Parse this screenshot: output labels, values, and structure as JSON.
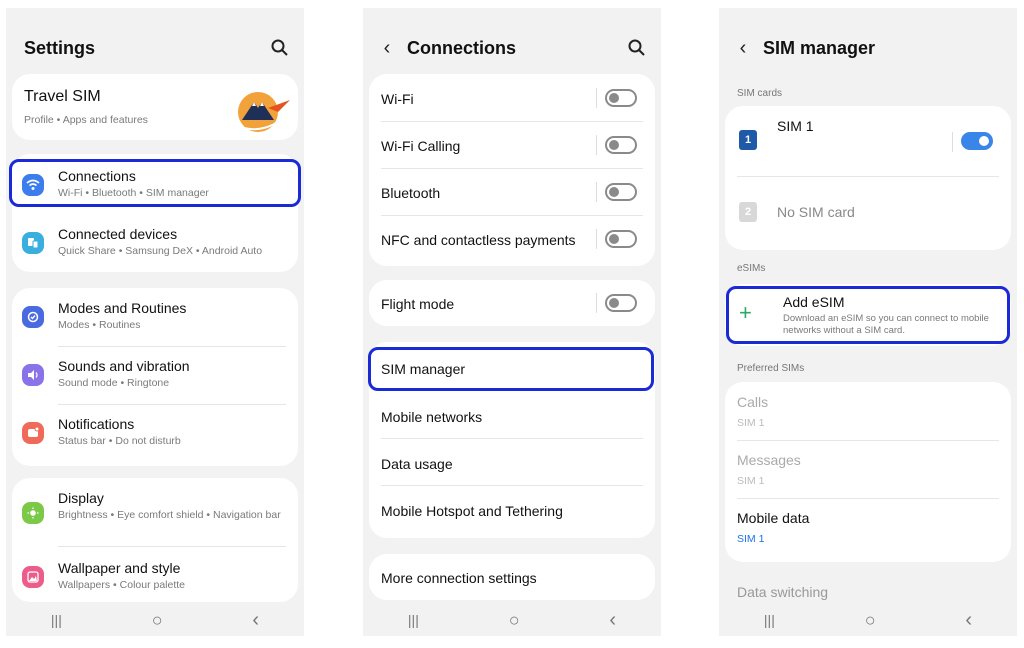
{
  "settings": {
    "title": "Settings",
    "profile": {
      "name": "Travel SIM",
      "sub": "Profile • Apps and features"
    },
    "items": [
      {
        "label": "Connections",
        "sub": "Wi-Fi • Bluetooth • SIM manager",
        "icon": "wifi-icon",
        "color": "#3b7ded"
      },
      {
        "label": "Connected devices",
        "sub": "Quick Share • Samsung DeX • Android Auto",
        "icon": "connected-devices-icon",
        "color": "#3aaede"
      },
      {
        "label": "Modes and Routines",
        "sub": "Modes • Routines",
        "icon": "modes-icon",
        "color": "#4a6be0"
      },
      {
        "label": "Sounds and vibration",
        "sub": "Sound mode • Ringtone",
        "icon": "sound-icon",
        "color": "#8a72e8"
      },
      {
        "label": "Notifications",
        "sub": "Status bar • Do not disturb",
        "icon": "notifications-icon",
        "color": "#f06a5a"
      },
      {
        "label": "Display",
        "sub": "Brightness • Eye comfort shield • Navigation bar",
        "icon": "display-icon",
        "color": "#7cc94a"
      },
      {
        "label": "Wallpaper and style",
        "sub": "Wallpapers • Colour palette",
        "icon": "wallpaper-icon",
        "color": "#ec5d8b"
      }
    ]
  },
  "connections": {
    "title": "Connections",
    "toggles": [
      {
        "label": "Wi-Fi",
        "on": false
      },
      {
        "label": "Wi-Fi Calling",
        "on": false
      },
      {
        "label": "Bluetooth",
        "on": false
      },
      {
        "label": "NFC and contactless payments",
        "on": false
      }
    ],
    "flight_mode": "Flight mode",
    "items": [
      "SIM manager",
      "Mobile networks",
      "Data usage",
      "Mobile Hotspot and Tethering"
    ],
    "more": "More connection settings"
  },
  "sim_manager": {
    "title": "SIM manager",
    "sim_cards_label": "SIM cards",
    "sim1": {
      "label": "SIM 1",
      "badge": "1",
      "on": true
    },
    "sim2": {
      "label": "No SIM card",
      "badge": "2"
    },
    "esims_label": "eSIMs",
    "add_esim": {
      "label": "Add eSIM",
      "sub": "Download an eSIM so you can connect to mobile networks without a SIM card."
    },
    "preferred_label": "Preferred SIMs",
    "calls": {
      "label": "Calls",
      "value": "SIM 1"
    },
    "messages": {
      "label": "Messages",
      "value": "SIM 1"
    },
    "mobile_data": {
      "label": "Mobile data",
      "value": "SIM 1"
    },
    "data_switching": "Data switching"
  },
  "nav": {
    "recents": "|||",
    "home": "○",
    "back": "‹"
  },
  "colors": {
    "highlight": "#1a2ad6",
    "toggle_on": "#3a86e8",
    "accent": "#1a73e8"
  }
}
